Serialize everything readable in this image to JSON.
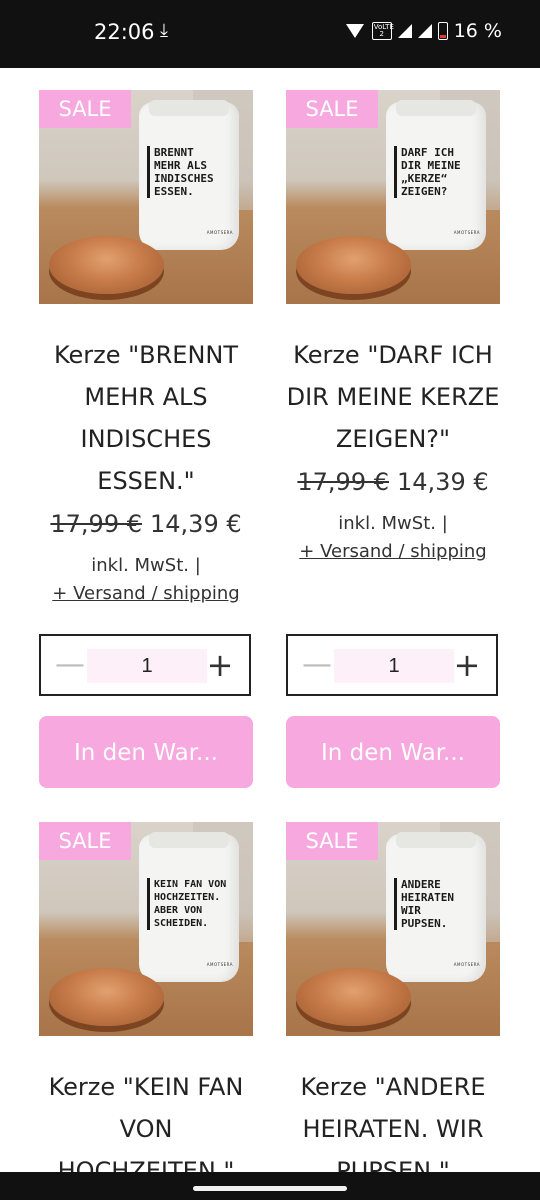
{
  "status_bar": {
    "time": "22:06",
    "download_glyph": "⤓",
    "volte": "VoLTE 2",
    "battery": "16 %"
  },
  "products": [
    {
      "badge": "SALE",
      "jar_text": "BRENNT\nMEHR ALS\nINDISCHES\nESSEN.",
      "title": "Kerze \"BRENNT MEHR ALS INDISCHES ESSEN.\"",
      "old_price": "17,99 €",
      "price": "14,39 €",
      "tax": "inkl. MwSt. |",
      "shipping": "+ Versand / shipping",
      "quantity": "1",
      "minus": "—",
      "plus": "+",
      "cart": "In den War..."
    },
    {
      "badge": "SALE",
      "jar_text": "DARF ICH\nDIR MEINE\n„KERZE“\nZEIGEN?",
      "title": "Kerze \"DARF ICH DIR MEINE KERZE ZEIGEN?\"",
      "old_price": "17,99 €",
      "price": "14,39 €",
      "tax": "inkl. MwSt. |",
      "shipping": "+ Versand / shipping",
      "quantity": "1",
      "minus": "—",
      "plus": "+",
      "cart": "In den War..."
    },
    {
      "badge": "SALE",
      "jar_text": "KEIN FAN VON\nHOCHZEITEN.\nABER VON\nSCHEIDEN.",
      "title": "Kerze \"KEIN FAN VON HOCHZEITEN.\"",
      "jar_brand": "AMOTSERA"
    },
    {
      "badge": "SALE",
      "jar_text": "ANDERE\nHEIRATEN\nWIR\nPUPSEN.",
      "title": "Kerze \"ANDERE HEIRATEN. WIR PUPSEN.\"",
      "jar_brand": "AMOTSERA"
    }
  ],
  "brand_mark": "AMOTSERA"
}
